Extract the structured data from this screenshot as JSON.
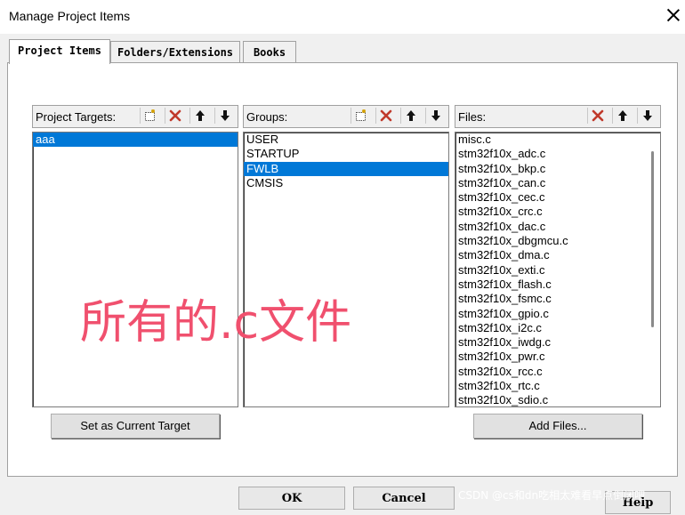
{
  "window": {
    "title": "Manage Project Items"
  },
  "tabs": [
    {
      "label": "Project Items"
    },
    {
      "label": "Folders/Extensions"
    },
    {
      "label": "Books"
    }
  ],
  "targets": {
    "label": "Project Targets:",
    "items": [
      "aaa"
    ],
    "selected": "aaa",
    "button_label": "Set as Current Target"
  },
  "groups": {
    "label": "Groups:",
    "items": [
      "USER",
      "STARTUP",
      "FWLB",
      "CMSIS"
    ],
    "selected": "FWLB"
  },
  "files": {
    "label": "Files:",
    "items": [
      "misc.c",
      "stm32f10x_adc.c",
      "stm32f10x_bkp.c",
      "stm32f10x_can.c",
      "stm32f10x_cec.c",
      "stm32f10x_crc.c",
      "stm32f10x_dac.c",
      "stm32f10x_dbgmcu.c",
      "stm32f10x_dma.c",
      "stm32f10x_exti.c",
      "stm32f10x_flash.c",
      "stm32f10x_fsmc.c",
      "stm32f10x_gpio.c",
      "stm32f10x_i2c.c",
      "stm32f10x_iwdg.c",
      "stm32f10x_pwr.c",
      "stm32f10x_rcc.c",
      "stm32f10x_rtc.c",
      "stm32f10x_sdio.c"
    ],
    "button_label": "Add Files..."
  },
  "toolbar_icons": {
    "new": "new-item-icon",
    "delete": "delete-icon",
    "up": "move-up-icon",
    "down": "move-down-icon"
  },
  "buttons": {
    "ok": "OK",
    "cancel": "Cancel",
    "help": "Help"
  },
  "annotation": {
    "text": "所有的.c文件",
    "color": "#f0506e"
  },
  "watermark": {
    "text": "CSDN @cs和dn吃相太难看早点倒闭吧"
  },
  "colors": {
    "selection": "#0078d7",
    "delete_icon": "#c0392b",
    "dialog_bg": "#f0f0f0"
  }
}
